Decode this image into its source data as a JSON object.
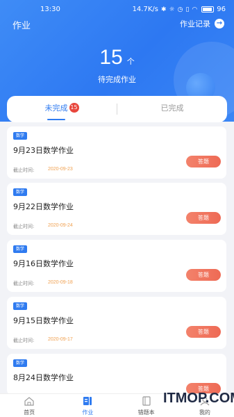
{
  "status_bar": {
    "time": "13:30",
    "speed": "14.7K/s",
    "battery": "96"
  },
  "header": {
    "title": "作业",
    "records_label": "作业记录",
    "records_icon": "arrow-right-icon"
  },
  "summary": {
    "count": "15",
    "unit": "个",
    "label": "待完成作业"
  },
  "tabs": {
    "incomplete_label": "未完成",
    "incomplete_badge": "15",
    "complete_label": "已完成"
  },
  "cards": [
    {
      "tag": "数学",
      "title": "9月23日数学作业",
      "deadline_label": "截止时间:",
      "deadline": "2020-09-23",
      "action": "答题"
    },
    {
      "tag": "数学",
      "title": "9月22日数学作业",
      "deadline_label": "截止时间:",
      "deadline": "2020-09-24",
      "action": "答题"
    },
    {
      "tag": "数学",
      "title": "9月16日数学作业",
      "deadline_label": "截止时间:",
      "deadline": "2020-09-18",
      "action": "答题"
    },
    {
      "tag": "数学",
      "title": "9月15日数学作业",
      "deadline_label": "截止时间:",
      "deadline": "2020-09-17",
      "action": "答题"
    },
    {
      "tag": "数学",
      "title": "8月24日数学作业",
      "deadline_label": "",
      "deadline": "",
      "action": "答题"
    }
  ],
  "nav": [
    {
      "label": "首页",
      "icon": "home-icon"
    },
    {
      "label": "作业",
      "icon": "homework-icon",
      "active": true
    },
    {
      "label": "错题本",
      "icon": "notebook-icon"
    },
    {
      "label": "我的",
      "icon": "profile-icon"
    }
  ],
  "watermark": "ITMOP.COM",
  "colors": {
    "primary": "#2f7bf0",
    "answer_button": "#ee6a55",
    "deadline": "#f0a050",
    "badge": "#e8463c"
  }
}
